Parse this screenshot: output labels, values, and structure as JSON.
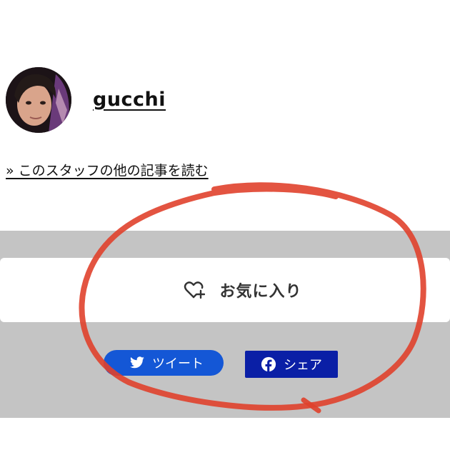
{
  "author": {
    "name": "gucchi",
    "avatar_icon": "person-photo"
  },
  "more_articles_link": "» このスタッフの他の記事を読む",
  "favorite": {
    "label": "お気に入り",
    "icon": "heart-plus-icon"
  },
  "share": {
    "tweet_label": "ツイート",
    "tweet_icon": "twitter-bird-icon",
    "facebook_label": "シェア",
    "facebook_icon": "facebook-icon"
  },
  "colors": {
    "band_gray": "#c4c4c4",
    "tweet_blue": "#1457d6",
    "facebook_blue": "#0a1fa6",
    "annotation_red": "#e0412c"
  }
}
